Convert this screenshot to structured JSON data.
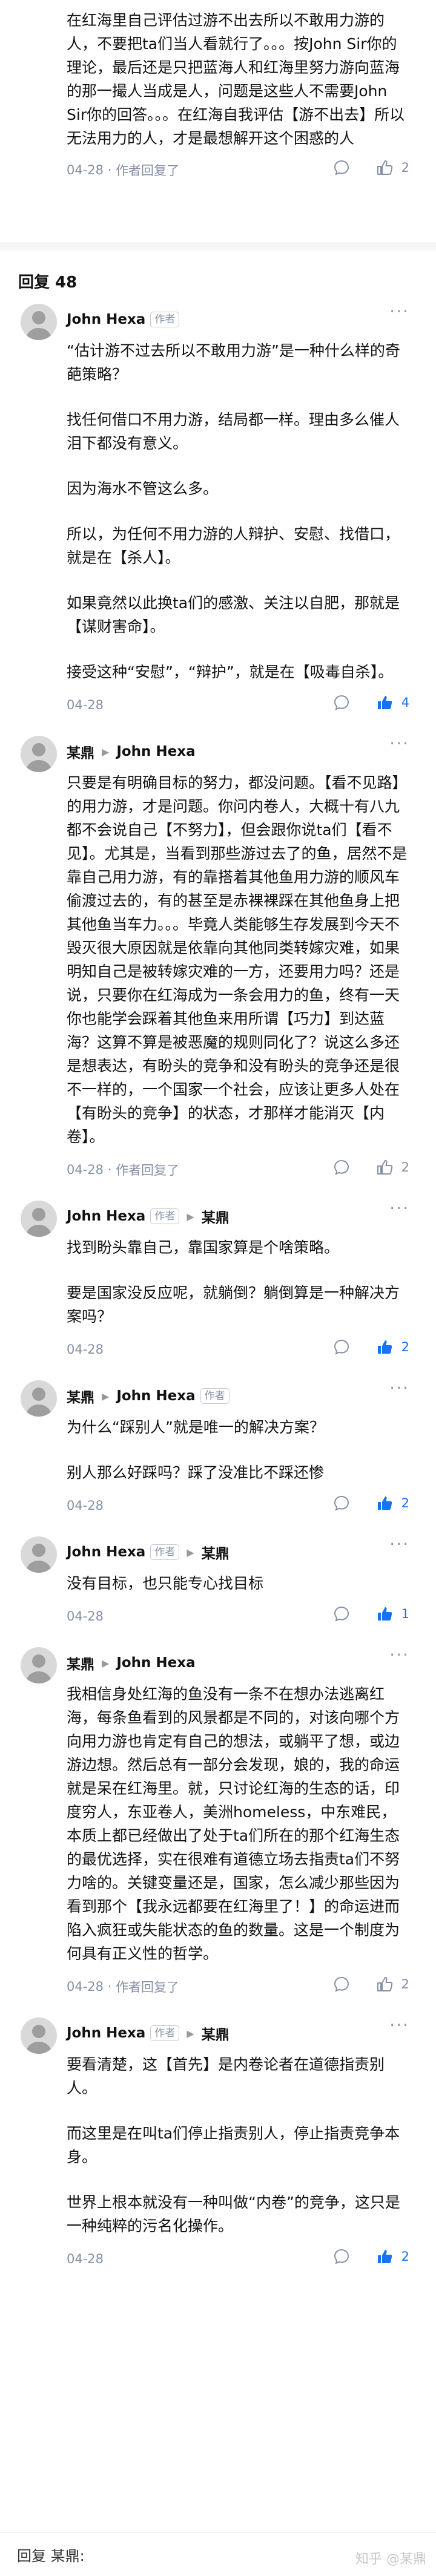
{
  "top_reply": {
    "content": "在红海里自己评估过游不出去所以不敢用力游的人，不要把ta们当人看就行了。。。按John Sir你的理论，最后还是只把蓝海人和红海里努力游向蓝海的那一撮人当成是人，问题是这些人不需要John Sir你的回答。。。在红海自我评估【游不出去】所以无法用力的人，才是最想解开这个困惑的人",
    "date": "04-28",
    "author_replied": "作者回复了",
    "likes": "2"
  },
  "section": {
    "title": "回复 48"
  },
  "comments": [
    {
      "author": "John Hexa",
      "badge": "作者",
      "paragraphs": [
        "“估计游不过去所以不敢用力游”是一种什么样的奇葩策略？",
        "找任何借口不用力游，结局都一样。理由多么催人泪下都没有意义。",
        "因为海水不管这么多。",
        "所以，为任何不用力游的人辩护、安慰、找借口，就是在【杀人】。",
        "如果竟然以此换ta们的感激、关注以自肥，那就是【谋财害命】。",
        "接受这种“安慰”，“辩护”，就是在【吸毒自杀】。"
      ],
      "date": "04-28",
      "likes": "4",
      "liked": true
    },
    {
      "author": "某鼎",
      "reply_to": "John Hexa",
      "paragraphs": [
        "只要是有明确目标的努力，都没问题。【看不见路】的用力游，才是问题。你问内卷人，大概十有八九都不会说自己【不努力】，但会跟你说ta们【看不见】。尤其是，当看到那些游过去了的鱼，居然不是靠自己用力游，有的靠搭着其他鱼用力游的顺风车偷渡过去的，有的甚至是赤裸裸踩在其他鱼身上把其他鱼当车力。。。毕竟人类能够生存发展到今天不毁灭很大原因就是依靠向其他同类转嫁灾难，如果明知自己是被转嫁灾难的一方，还要用力吗？还是说，只要你在红海成为一条会用力的鱼，终有一天你也能学会踩着其他鱼来用所谓【巧力】到达蓝海？这算不算是被恶魔的规则同化了？说这么多还是想表达，有盼头的竞争和没有盼头的竞争还是很不一样的，一个国家一个社会，应该让更多人处在【有盼头的竞争】的状态，才那样才能消灭【内卷】。"
      ],
      "date": "04-28",
      "author_replied": "作者回复了",
      "likes": "2",
      "liked": false
    },
    {
      "author": "John Hexa",
      "badge": "作者",
      "reply_to": "某鼎",
      "paragraphs": [
        "找到盼头靠自己，靠国家算是个啥策略。",
        "要是国家没反应呢，就躺倒？躺倒算是一种解决方案吗？"
      ],
      "date": "04-28",
      "likes": "2",
      "liked": true
    },
    {
      "author": "某鼎",
      "reply_to": "John Hexa",
      "reply_badge": "作者",
      "paragraphs": [
        "为什么“踩别人”就是唯一的解决方案？",
        "别人那么好踩吗？踩了没准比不踩还惨"
      ],
      "date": "04-28",
      "likes": "2",
      "liked": true
    },
    {
      "author": "John Hexa",
      "badge": "作者",
      "reply_to": "某鼎",
      "paragraphs": [
        "没有目标，也只能专心找目标"
      ],
      "date": "04-28",
      "likes": "1",
      "liked": true
    },
    {
      "author": "某鼎",
      "reply_to": "John Hexa",
      "paragraphs": [
        "我相信身处红海的鱼没有一条不在想办法逃离红海，每条鱼看到的风景都是不同的，对该向哪个方向用力游也肯定有自己的想法，或躺平了想，或边游边想。然后总有一部分会发现，娘的，我的命运就是呆在红海里。就，只讨论红海的生态的话，印度穷人，东亚卷人，美洲homeless，中东难民，本质上都已经做出了处于ta们所在的那个红海生态的最优选择，实在很难有道德立场去指责ta们不努力啥的。关键变量还是，国家，怎么减少那些因为看到那个【我永远都要在红海里了！】的命运进而陷入疯狂或失能状态的鱼的数量。这是一个制度为何具有正义性的哲学。"
      ],
      "date": "04-28",
      "author_replied": "作者回复了",
      "likes": "2",
      "liked": false
    },
    {
      "author": "John Hexa",
      "badge": "作者",
      "reply_to": "某鼎",
      "paragraphs": [
        "要看清楚，这【首先】是内卷论者在道德指责别人。",
        "而这里是在叫ta们停止指责别人，停止指责竞争本身。",
        "世界上根本就没有一种叫做“内卷”的竞争，这只是一种纯粹的污名化操作。"
      ],
      "date": "04-28",
      "likes": "2",
      "liked": true
    }
  ],
  "bottom_bar": {
    "reply_to": "回复 某鼎:"
  },
  "watermark": "知乎 @某鼎",
  "colors": {
    "like_active": "#1772f6",
    "meta_gray": "#8590a6"
  }
}
